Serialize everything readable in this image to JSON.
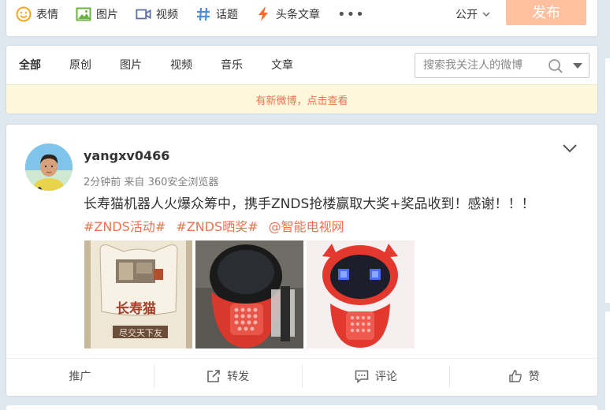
{
  "composer": {
    "tools": [
      {
        "label": "表情",
        "icon": "smiley-icon"
      },
      {
        "label": "图片",
        "icon": "image-icon"
      },
      {
        "label": "视频",
        "icon": "video-icon"
      },
      {
        "label": "话题",
        "icon": "hashtag-icon"
      },
      {
        "label": "头条文章",
        "icon": "lightning-icon"
      }
    ],
    "more": "•••",
    "visibility": "公开",
    "publish": "发布",
    "colors": {
      "publish_bg": "#ffc09f",
      "accent": "#eb7350"
    }
  },
  "filter": {
    "tabs": [
      "全部",
      "原创",
      "图片",
      "视频",
      "音乐",
      "文章"
    ],
    "active_tab": "全部",
    "search_placeholder": "搜索我关注人的微博",
    "notice": "有新微博，点击查看"
  },
  "post": {
    "username": "yangxv0466",
    "time": "2分钟前",
    "source_prefix": "来自",
    "source": "360安全浏览器",
    "text": "长寿猫机器人火爆众筹中，携手ZNDS抢楼赢取大奖+奖品收到！感谢！！！",
    "tags": [
      "#ZNDS活动#",
      "#ZNDS晒奖#",
      "@智能电视网"
    ],
    "photo1_caption": "长寿猫",
    "photo1_slogan": "尽交天下友",
    "actions": [
      {
        "label": "推广",
        "icon": ""
      },
      {
        "label": "转发",
        "icon": "repost-icon"
      },
      {
        "label": "评论",
        "icon": "comment-icon"
      },
      {
        "label": "赞",
        "icon": "like-icon"
      }
    ]
  }
}
